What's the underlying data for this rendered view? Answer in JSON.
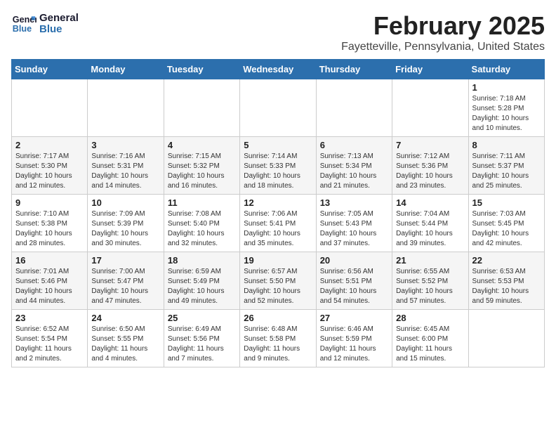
{
  "logo": {
    "line1": "General",
    "line2": "Blue"
  },
  "title": "February 2025",
  "location": "Fayetteville, Pennsylvania, United States",
  "days_of_week": [
    "Sunday",
    "Monday",
    "Tuesday",
    "Wednesday",
    "Thursday",
    "Friday",
    "Saturday"
  ],
  "weeks": [
    [
      {
        "day": "",
        "info": ""
      },
      {
        "day": "",
        "info": ""
      },
      {
        "day": "",
        "info": ""
      },
      {
        "day": "",
        "info": ""
      },
      {
        "day": "",
        "info": ""
      },
      {
        "day": "",
        "info": ""
      },
      {
        "day": "1",
        "info": "Sunrise: 7:18 AM\nSunset: 5:28 PM\nDaylight: 10 hours\nand 10 minutes."
      }
    ],
    [
      {
        "day": "2",
        "info": "Sunrise: 7:17 AM\nSunset: 5:30 PM\nDaylight: 10 hours\nand 12 minutes."
      },
      {
        "day": "3",
        "info": "Sunrise: 7:16 AM\nSunset: 5:31 PM\nDaylight: 10 hours\nand 14 minutes."
      },
      {
        "day": "4",
        "info": "Sunrise: 7:15 AM\nSunset: 5:32 PM\nDaylight: 10 hours\nand 16 minutes."
      },
      {
        "day": "5",
        "info": "Sunrise: 7:14 AM\nSunset: 5:33 PM\nDaylight: 10 hours\nand 18 minutes."
      },
      {
        "day": "6",
        "info": "Sunrise: 7:13 AM\nSunset: 5:34 PM\nDaylight: 10 hours\nand 21 minutes."
      },
      {
        "day": "7",
        "info": "Sunrise: 7:12 AM\nSunset: 5:36 PM\nDaylight: 10 hours\nand 23 minutes."
      },
      {
        "day": "8",
        "info": "Sunrise: 7:11 AM\nSunset: 5:37 PM\nDaylight: 10 hours\nand 25 minutes."
      }
    ],
    [
      {
        "day": "9",
        "info": "Sunrise: 7:10 AM\nSunset: 5:38 PM\nDaylight: 10 hours\nand 28 minutes."
      },
      {
        "day": "10",
        "info": "Sunrise: 7:09 AM\nSunset: 5:39 PM\nDaylight: 10 hours\nand 30 minutes."
      },
      {
        "day": "11",
        "info": "Sunrise: 7:08 AM\nSunset: 5:40 PM\nDaylight: 10 hours\nand 32 minutes."
      },
      {
        "day": "12",
        "info": "Sunrise: 7:06 AM\nSunset: 5:41 PM\nDaylight: 10 hours\nand 35 minutes."
      },
      {
        "day": "13",
        "info": "Sunrise: 7:05 AM\nSunset: 5:43 PM\nDaylight: 10 hours\nand 37 minutes."
      },
      {
        "day": "14",
        "info": "Sunrise: 7:04 AM\nSunset: 5:44 PM\nDaylight: 10 hours\nand 39 minutes."
      },
      {
        "day": "15",
        "info": "Sunrise: 7:03 AM\nSunset: 5:45 PM\nDaylight: 10 hours\nand 42 minutes."
      }
    ],
    [
      {
        "day": "16",
        "info": "Sunrise: 7:01 AM\nSunset: 5:46 PM\nDaylight: 10 hours\nand 44 minutes."
      },
      {
        "day": "17",
        "info": "Sunrise: 7:00 AM\nSunset: 5:47 PM\nDaylight: 10 hours\nand 47 minutes."
      },
      {
        "day": "18",
        "info": "Sunrise: 6:59 AM\nSunset: 5:49 PM\nDaylight: 10 hours\nand 49 minutes."
      },
      {
        "day": "19",
        "info": "Sunrise: 6:57 AM\nSunset: 5:50 PM\nDaylight: 10 hours\nand 52 minutes."
      },
      {
        "day": "20",
        "info": "Sunrise: 6:56 AM\nSunset: 5:51 PM\nDaylight: 10 hours\nand 54 minutes."
      },
      {
        "day": "21",
        "info": "Sunrise: 6:55 AM\nSunset: 5:52 PM\nDaylight: 10 hours\nand 57 minutes."
      },
      {
        "day": "22",
        "info": "Sunrise: 6:53 AM\nSunset: 5:53 PM\nDaylight: 10 hours\nand 59 minutes."
      }
    ],
    [
      {
        "day": "23",
        "info": "Sunrise: 6:52 AM\nSunset: 5:54 PM\nDaylight: 11 hours\nand 2 minutes."
      },
      {
        "day": "24",
        "info": "Sunrise: 6:50 AM\nSunset: 5:55 PM\nDaylight: 11 hours\nand 4 minutes."
      },
      {
        "day": "25",
        "info": "Sunrise: 6:49 AM\nSunset: 5:56 PM\nDaylight: 11 hours\nand 7 minutes."
      },
      {
        "day": "26",
        "info": "Sunrise: 6:48 AM\nSunset: 5:58 PM\nDaylight: 11 hours\nand 9 minutes."
      },
      {
        "day": "27",
        "info": "Sunrise: 6:46 AM\nSunset: 5:59 PM\nDaylight: 11 hours\nand 12 minutes."
      },
      {
        "day": "28",
        "info": "Sunrise: 6:45 AM\nSunset: 6:00 PM\nDaylight: 11 hours\nand 15 minutes."
      },
      {
        "day": "",
        "info": ""
      }
    ]
  ]
}
